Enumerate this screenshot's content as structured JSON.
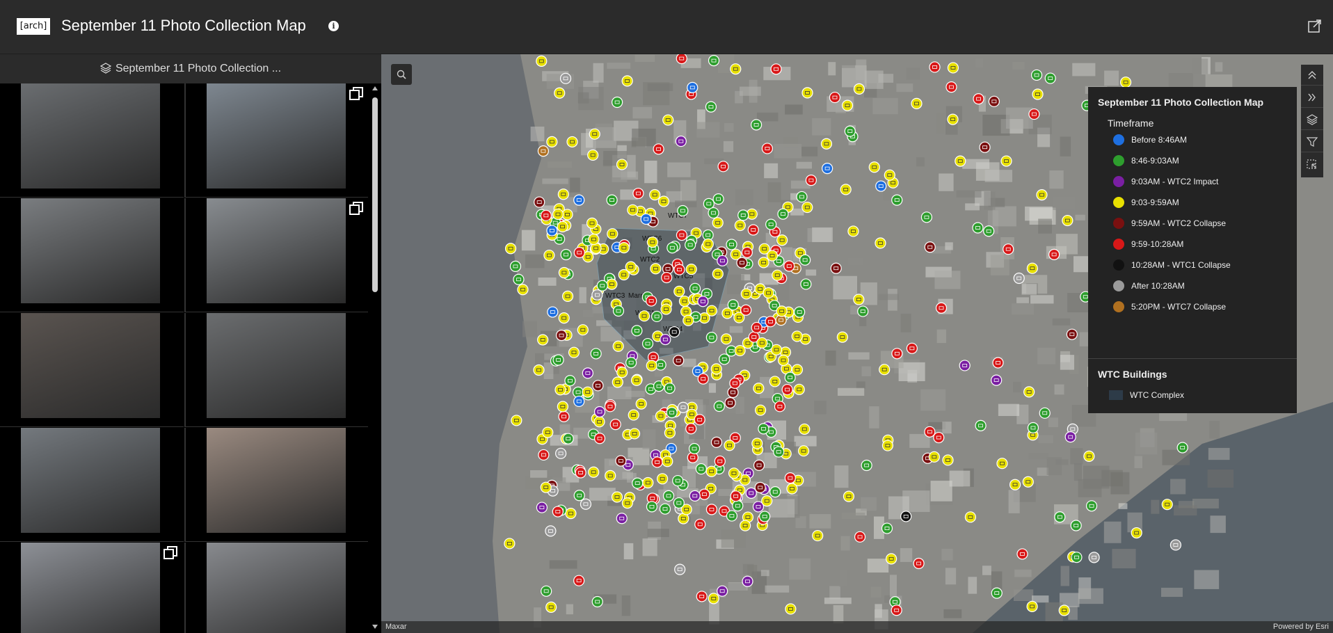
{
  "header": {
    "logo_text": "[arch]",
    "title": "September 11 Photo Collection Map"
  },
  "sidebar": {
    "title": "September 11 Photo Collection ...",
    "photos": [
      {
        "tone": "#6a6d70",
        "multi": false
      },
      {
        "tone": "#7e8790",
        "multi": true
      },
      {
        "tone": "#7a7d80",
        "multi": false
      },
      {
        "tone": "#888c90",
        "multi": true
      },
      {
        "tone": "#5a5450",
        "multi": false
      },
      {
        "tone": "#6b6d6f",
        "multi": false
      },
      {
        "tone": "#74797e",
        "multi": false
      },
      {
        "tone": "#9a8a80",
        "multi": false
      },
      {
        "tone": "#8d9096",
        "multi": true
      },
      {
        "tone": "#888a8e",
        "multi": false
      }
    ]
  },
  "map": {
    "attribution_left": "Maxar",
    "attribution_right": "Powered by Esri",
    "building_labels": [
      "WTC7",
      "WTC6",
      "WTC2",
      "WTC5",
      "WTC3",
      "Marriott",
      "WTC1",
      "WTC4"
    ],
    "legend": {
      "title": "September 11 Photo Collection Map",
      "subtitle": "Timeframe",
      "items": [
        {
          "label": "Before 8:46AM",
          "color": "#1e6fe0"
        },
        {
          "label": "8:46-9:03AM",
          "color": "#2e9e2e"
        },
        {
          "label": "9:03AM - WTC2 Impact",
          "color": "#7a1fa2"
        },
        {
          "label": "9:03-9:59AM",
          "color": "#e8e000"
        },
        {
          "label": "9:59AM - WTC2 Collapse",
          "color": "#7a1010"
        },
        {
          "label": "9:59-10:28AM",
          "color": "#d81818"
        },
        {
          "label": "10:28AM - WTC1 Collapse",
          "color": "#111111"
        },
        {
          "label": "After 10:28AM",
          "color": "#9a9a9a"
        },
        {
          "label": "5:20PM - WTC7 Collapse",
          "color": "#b07020"
        }
      ],
      "buildings_title": "WTC Buildings",
      "buildings_item": "WTC Complex"
    }
  }
}
